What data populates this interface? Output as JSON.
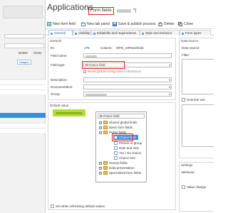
{
  "app": {
    "title": "Applications",
    "subtitle_label": "Form fields",
    "subtitle_suffix": "*)"
  },
  "background_window": {
    "buttons": [
      "Delete",
      "Clone"
    ],
    "tab_label": "Usages"
  },
  "toolbar": {
    "new_form_field": "New form field",
    "new_tab_panel": "New tab panel",
    "save_publish": "Save & publish process",
    "delete": "Delete",
    "clone": "Clone"
  },
  "tabs": [
    {
      "label": "General",
      "active": true
    },
    {
      "label": "Visibility",
      "active": false
    },
    {
      "label": "Editability and requiredness",
      "active": false
    },
    {
      "label": "Style and behavior",
      "active": false
    },
    {
      "label": "Form types",
      "active": false
    }
  ],
  "general": {
    "header": "General",
    "id_label": "ID:",
    "id_value": "179",
    "column_label": "Column:",
    "column_value": "WFD_AttText2Glob",
    "field_name_label": "Field name:",
    "field_type_label": "Field type:",
    "field_type_value": "Choice field",
    "global_config_label": "Break global configuration inheritance",
    "description_label": "Description:",
    "documentation_label": "Documentation:",
    "group_label": "Group:"
  },
  "default_value": {
    "header": "Default value",
    "refresh_label": "Set when refreshing default values"
  },
  "tree": {
    "search_value": "Choice field",
    "items": [
      {
        "label": "Shared global fields",
        "kind": "folder",
        "expanded": false,
        "level": 0
      },
      {
        "label": "Basic form fields",
        "kind": "folder",
        "expanded": false,
        "level": 0
      },
      {
        "label": "Picker fields",
        "kind": "folder",
        "expanded": true,
        "level": 0
      },
      {
        "label": "Choice field",
        "kind": "leaf",
        "selected": true,
        "level": 1
      },
      {
        "label": "Person or group",
        "kind": "leaf",
        "level": 1
      },
      {
        "label": "Date and time",
        "kind": "leaf",
        "level": 1
      },
      {
        "label": "Yes / No choice",
        "kind": "leaf",
        "level": 1
      },
      {
        "label": "Choice tree",
        "kind": "leaf",
        "level": 1
      },
      {
        "label": "Survey fields",
        "kind": "folder",
        "expanded": false,
        "level": 0
      },
      {
        "label": "Data presentation",
        "kind": "folder",
        "expanded": false,
        "level": 0
      },
      {
        "label": "Specialized form fields",
        "kind": "folder",
        "expanded": false,
        "level": 0
      }
    ]
  },
  "data_source": {
    "header": "Data source",
    "source_label": "Data source:",
    "filter_label": "Filter:",
    "override_sort_label": "Override sort"
  },
  "settings": {
    "header": "Settings",
    "behavior_label": "Behavior:",
    "value_change_label": "Value change"
  },
  "colors": {
    "highlight": "#e02020",
    "selection": "#3a8ee6",
    "accent": "#245a9b",
    "default_value_chip": "#b5dc34"
  }
}
